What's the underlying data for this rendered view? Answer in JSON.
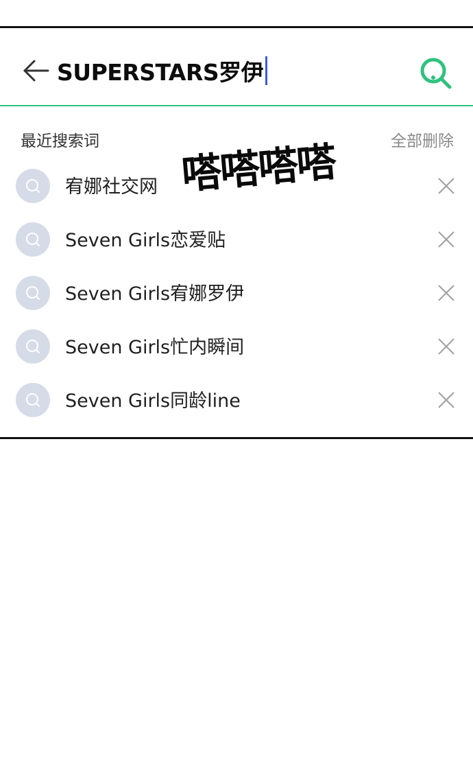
{
  "search": {
    "query": "SUPERSTARS罗伊",
    "back_icon": "arrow-left-icon",
    "search_icon": "search-icon",
    "accent_color": "#2ec27e",
    "caret_color": "#3b5bdb"
  },
  "history": {
    "title": "最近搜索词",
    "delete_all_label": "全部删除",
    "items": [
      {
        "label": "宥娜社交网"
      },
      {
        "label": "Seven Girls恋爱贴"
      },
      {
        "label": "Seven Girls宥娜罗伊"
      },
      {
        "label": "Seven Girls忙内瞬间"
      },
      {
        "label": "Seven Girls同龄line"
      }
    ]
  },
  "overlay": {
    "sticker_text": "嗒嗒嗒嗒"
  }
}
